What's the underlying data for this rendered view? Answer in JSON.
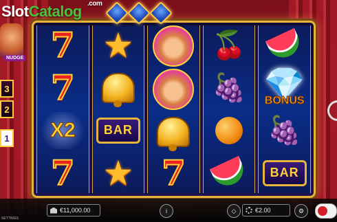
{
  "logo": {
    "slot": "Slot",
    "catalog": "Catalog",
    "com": ".com"
  },
  "side_panel": {
    "nudge_label": "NUDGE",
    "nudges": [
      "3",
      "2",
      "1"
    ]
  },
  "reels": [
    [
      {
        "type": "seven",
        "label": "7"
      },
      {
        "type": "seven",
        "label": "7"
      },
      {
        "type": "x2",
        "label": "X2"
      },
      {
        "type": "seven",
        "label": "7"
      }
    ],
    [
      {
        "type": "star",
        "label": "★"
      },
      {
        "type": "bell",
        "label": ""
      },
      {
        "type": "bar",
        "label": "BAR"
      },
      {
        "type": "star",
        "label": "★"
      }
    ],
    [
      {
        "type": "jester",
        "label": ""
      },
      {
        "type": "jester",
        "label": ""
      },
      {
        "type": "bell",
        "label": ""
      },
      {
        "type": "seven",
        "label": "7"
      }
    ],
    [
      {
        "type": "cherry",
        "label": "🍒"
      },
      {
        "type": "grape",
        "label": "🍇"
      },
      {
        "type": "orange",
        "label": ""
      },
      {
        "type": "melon",
        "label": ""
      }
    ],
    [
      {
        "type": "melon",
        "label": ""
      },
      {
        "type": "diamond",
        "label": "💎",
        "bonus": "BONUS"
      },
      {
        "type": "grape",
        "label": "🍇"
      },
      {
        "type": "bar",
        "label": "BAR"
      }
    ]
  ],
  "footer": {
    "balance": "€11,000.00",
    "bet": "€2.00",
    "tiny": "SETTINGS"
  },
  "colors": {
    "frame": "#e8b33a",
    "seven": "#e8221f",
    "accent": "#ffd23a"
  }
}
